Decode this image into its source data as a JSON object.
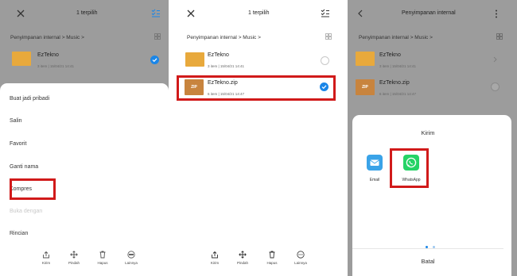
{
  "panel1": {
    "header": {
      "title": "1  terpilih"
    },
    "breadcrumb": {
      "root": "Penyimpanan internal",
      "folder": "Music"
    },
    "file": {
      "name": "EzTekno",
      "meta": "3 item  |  15/04/21 14:41"
    },
    "menu": [
      {
        "label": "Buat jadi pribadi"
      },
      {
        "label": "Salin"
      },
      {
        "label": "Favorit"
      },
      {
        "label": "Ganti nama"
      },
      {
        "label": "Kompres"
      },
      {
        "label": "Buka dengan"
      },
      {
        "label": "Rincian"
      }
    ],
    "bottom_bar": [
      {
        "label": "Kirim",
        "icon": "share-icon"
      },
      {
        "label": "Pindah",
        "icon": "move-icon"
      },
      {
        "label": "Hapus",
        "icon": "trash-icon"
      },
      {
        "label": "Lainnya",
        "icon": "more-icon"
      }
    ]
  },
  "panel2": {
    "header": {
      "title": "1  terpilih"
    },
    "breadcrumb": {
      "root": "Penyimpanan internal",
      "folder": "Music"
    },
    "files": [
      {
        "name": "EzTekno",
        "meta": "3 item  |  15/04/21 14:41",
        "selected": false
      },
      {
        "name": "EzTekno.zip",
        "meta": "6 item  |  15/04/21 14:47",
        "thumb": "ZIP",
        "selected": true
      }
    ],
    "bottom_bar": [
      {
        "label": "Kirim",
        "icon": "share-icon"
      },
      {
        "label": "Pindah",
        "icon": "move-icon"
      },
      {
        "label": "Hapus",
        "icon": "trash-icon"
      },
      {
        "label": "Lainnya",
        "icon": "more-icon"
      }
    ]
  },
  "panel3": {
    "header": {
      "title": "Penyimpanan internal"
    },
    "breadcrumb": {
      "root": "Penyimpanan internal",
      "folder": "Music"
    },
    "files": [
      {
        "name": "EzTekno",
        "meta": "3 item  |  15/04/21 14:41"
      },
      {
        "name": "EzTekno.zip",
        "meta": "6 item  |  15/04/21 14:47",
        "thumb": "ZIP"
      }
    ],
    "share_sheet": {
      "title": "Kirim",
      "apps": [
        {
          "label": "Email",
          "icon": "email-icon",
          "color": "#3aa3e8"
        },
        {
          "label": "WhatsApp",
          "icon": "whatsapp-icon",
          "color": "#25d366"
        }
      ],
      "cancel_label": "Batal"
    }
  },
  "colors": {
    "highlight": "#d11a1a",
    "accent": "#1a86e8",
    "folder": "#e8a93c",
    "zip": "#c8843e",
    "dim_overlay": "#9c9c9c"
  }
}
